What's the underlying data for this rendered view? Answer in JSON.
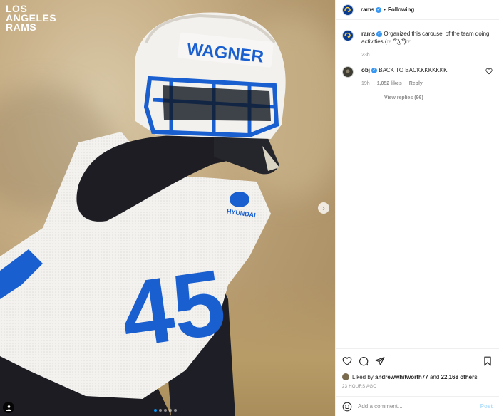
{
  "media": {
    "logo_lines": [
      "LOS",
      "ANGELES",
      "RAMS"
    ],
    "helmet_nameplate": "WAGNER",
    "jersey_number": "45",
    "sponsor": "HYUNDAI",
    "next_icon": "chevron-right-icon",
    "carousel_dots": 5,
    "active_dot": 0
  },
  "header": {
    "username": "rams",
    "follow_state": "Following",
    "avatar_icon": "rams-logo"
  },
  "caption": {
    "username": "rams",
    "text": "Organized this carousel of the team doing activities (☞ ͡° ͜ʖ ͡°)☞",
    "age": "23h"
  },
  "comments": [
    {
      "username": "obj",
      "text": "BACK TO BACKKKKKKKK",
      "age": "19h",
      "likes": "1,052 likes",
      "reply_label": "Reply",
      "view_replies": "View replies (96)"
    }
  ],
  "actions": {
    "icons": [
      "heart-icon",
      "comment-icon",
      "share-icon",
      "bookmark-icon"
    ]
  },
  "likes": {
    "prefix": "Liked by",
    "user": "andrewwhitworth77",
    "conjunction": "and",
    "others": "22,168 others"
  },
  "timestamp": "23 HOURS AGO",
  "add_comment": {
    "placeholder": "Add a comment...",
    "post_label": "Post"
  },
  "colors": {
    "rams_blue": "#0a3d91",
    "jersey_blue": "#1a5fd0",
    "link_blue": "#0095f6",
    "verified": "#3897f0"
  }
}
